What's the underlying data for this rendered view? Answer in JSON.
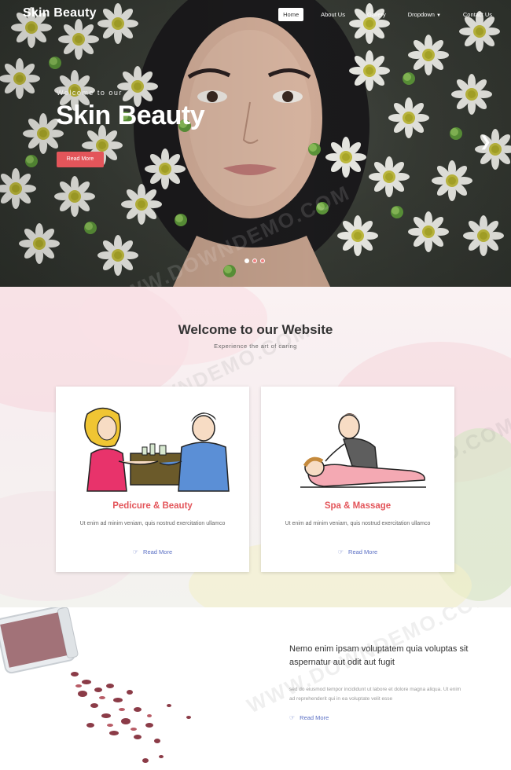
{
  "brand": "Skin Beauty",
  "nav": [
    {
      "label": "Home",
      "active": true
    },
    {
      "label": "About Us",
      "active": false
    },
    {
      "label": "Gallery",
      "active": false
    },
    {
      "label": "Dropdown",
      "active": false,
      "has_caret": true
    },
    {
      "label": "Contact Us",
      "active": false
    }
  ],
  "hero": {
    "kicker": "Welcome to our",
    "title": "Skin Beauty",
    "button": "Read More",
    "next_icon": "chevron-right-icon",
    "slides": 3,
    "active_slide": 1
  },
  "watermark": "WWW.DOWNDEMO.COM",
  "welcome": {
    "title": "Welcome to our Website",
    "subtitle": "Experience the art of caring"
  },
  "cards": [
    {
      "title": "Pedicure & Beauty",
      "text": "Ut enim ad minim veniam, quis nostrud exercitation ullamco",
      "link": "Read More",
      "link_icon": "hand-pointer-icon",
      "image": "manicure-illustration"
    },
    {
      "title": "Spa & Massage",
      "text": "Ut enim ad minim veniam, quis nostrud exercitation ullamco",
      "link": "Read More",
      "link_icon": "hand-pointer-icon",
      "image": "massage-illustration"
    }
  ],
  "about": {
    "title": "Nemo enim ipsam voluptatem quia voluptas sit aspernatur aut odit aut fugit",
    "text": "sed do eiusmod tempor incididunt ut labore et dolore magna aliqua. Ut enim ad reprehenderit qui in ea voluptate velit esse",
    "link": "Read More",
    "link_icon": "hand-pointer-icon",
    "image": "dried-rose-petals-jar"
  },
  "colors": {
    "accent": "#e3555a",
    "link": "#5a6fc4",
    "text": "#333333",
    "muted": "#999999"
  }
}
